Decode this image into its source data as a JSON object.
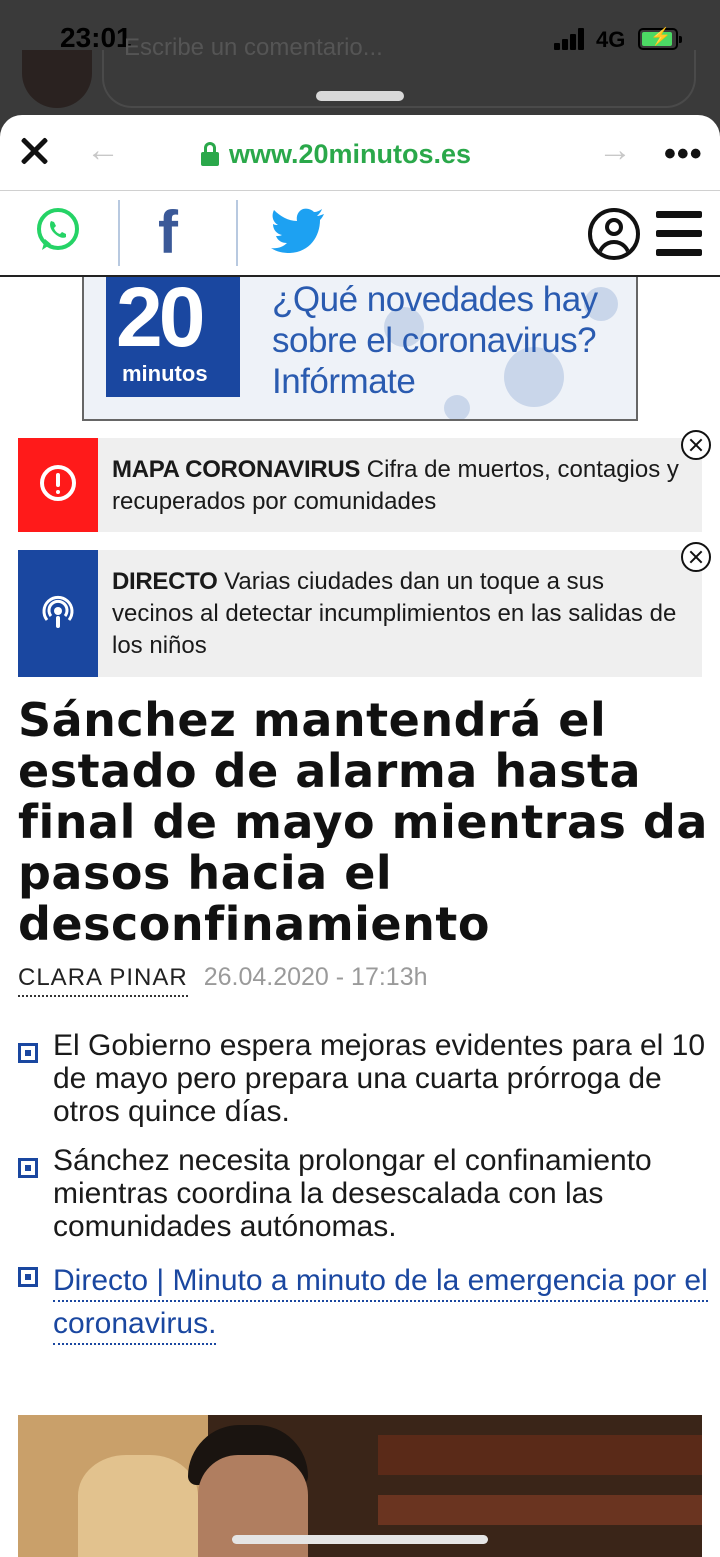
{
  "status_bar": {
    "time": "23:01",
    "network": "4G",
    "battery_state": "charging"
  },
  "background_app": {
    "comment_placeholder": "Escribe un comentario..."
  },
  "browser": {
    "url": "www.20minutos.es",
    "back_label": "←",
    "forward_label": "→",
    "more_label": "•••"
  },
  "social": {
    "facebook_glyph": "f"
  },
  "banner": {
    "logo_number": "20",
    "logo_word": "minutos",
    "text": "¿Qué novedades hay sobre el coronavirus? Infórmate"
  },
  "alerts": [
    {
      "tag": "MAPA CORONAVIRUS",
      "text": "Cifra de muertos, contagios y recuperados por comunidades",
      "color": "#ff1a1a",
      "icon": "alert-circle-icon"
    },
    {
      "tag": "DIRECTO",
      "text": "Varias ciudades dan un toque a sus vecinos al detectar incumplimientos en las salidas de los niños",
      "color": "#1a47a0",
      "icon": "podcast-icon"
    }
  ],
  "article": {
    "headline": "Sánchez mantendrá el estado de alarma hasta final de mayo mientras da pasos hacia el desconfinamiento",
    "author": "CLARA PINAR",
    "date": "26.04.2020 - 17:13h",
    "bullets": [
      "El Gobierno espera mejoras evidentes para el 10 de mayo pero prepara una cuarta prórroga de otros quince días.",
      "Sánchez necesita prolongar el confinamiento mientras coordina la desescalada con las comunidades autónomas."
    ],
    "link_bullet": "Directo | Minuto a minuto de la emergencia por el coronavirus."
  },
  "colors": {
    "brand_blue": "#1a47a0",
    "url_green": "#2aa84a",
    "alert_red": "#ff1a1a",
    "whatsapp_green": "#25d366",
    "twitter_blue": "#1da1f2",
    "facebook_blue": "#3b5998"
  }
}
